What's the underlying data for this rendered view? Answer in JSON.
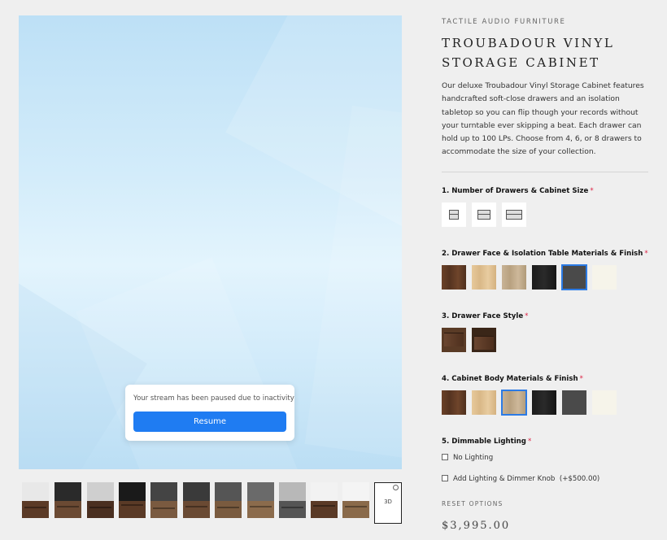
{
  "viewer": {
    "pause_message": "Your stream has been paused due to inactivity",
    "resume_label": "Resume"
  },
  "thumbnails": {
    "count": 11,
    "last_label": "3D"
  },
  "product": {
    "brand": "TACTILE AUDIO FURNITURE",
    "title": "TROUBADOUR VINYL STORAGE CABINET",
    "description": "Our deluxe Troubadour Vinyl Storage Cabinet features handcrafted soft-close drawers and an isolation tabletop so you can flip though your records without your turntable ever skipping a beat. Each drawer can hold up to 100 LPs. Choose from 4, 6, or 8 drawers to accommodate the size of your collection.",
    "price": "$3,995.00"
  },
  "options": {
    "required_mark": "*",
    "drawers": {
      "label": "1. Number of Drawers & Cabinet Size",
      "choices": [
        "4-drawer",
        "6-drawer",
        "8-drawer"
      ]
    },
    "drawer_face_material": {
      "label": "2. Drawer Face & Isolation Table Materials & Finish",
      "swatches": [
        "walnut",
        "maple",
        "oak",
        "black",
        "grey",
        "white"
      ],
      "selected_index": 4
    },
    "drawer_face_style": {
      "label": "3. Drawer Face Style",
      "choices": [
        "style-1",
        "style-2"
      ]
    },
    "cabinet_body_material": {
      "label": "4. Cabinet Body Materials & Finish",
      "swatches": [
        "walnut",
        "maple",
        "oak",
        "black",
        "grey",
        "white"
      ],
      "selected_index": 2
    },
    "lighting": {
      "label": "5. Dimmable Lighting",
      "choices": [
        {
          "label": "No Lighting",
          "checked": false
        },
        {
          "label": "Add Lighting & Dimmer Knob",
          "extra": "(+$500.00)",
          "checked": false
        }
      ]
    },
    "reset_label": "RESET OPTIONS"
  }
}
